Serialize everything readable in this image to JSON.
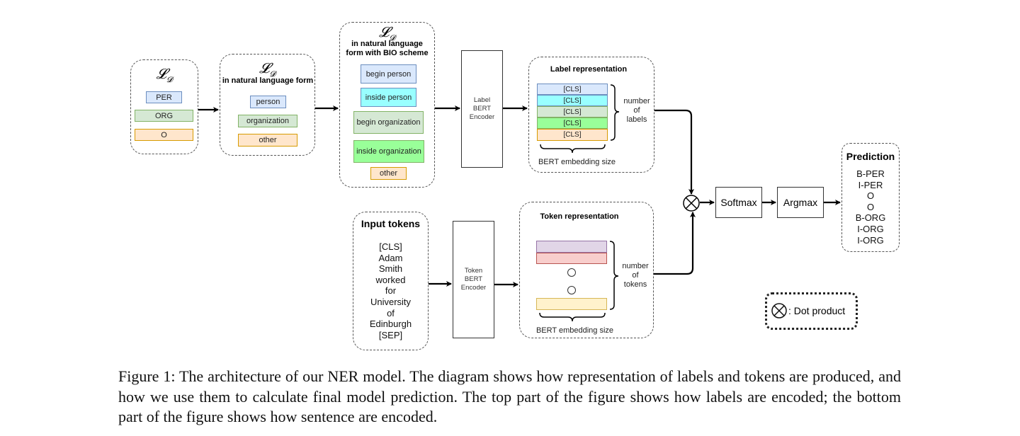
{
  "domain": "Diagram",
  "label_set": {
    "symbol": "𝓛",
    "subscript": "𝓓",
    "items": [
      {
        "text": "PER",
        "color": "#dae8fc"
      },
      {
        "text": "ORG",
        "color": "#d5e8d4"
      },
      {
        "text": "O",
        "color": "#ffe6cc"
      }
    ]
  },
  "label_set_natural": {
    "symbol": "𝓛",
    "subscript": "𝓓",
    "title": "in natural language form",
    "items": [
      {
        "text": "person",
        "color": "#dae8fc"
      },
      {
        "text": "organization",
        "color": "#d5e8d4"
      },
      {
        "text": "other",
        "color": "#ffe6cc"
      }
    ]
  },
  "label_set_bio": {
    "symbol": "𝓛",
    "subscript": "𝓓",
    "title_line1": "in natural language",
    "title_line2": "form with BIO scheme",
    "items": [
      {
        "text": "begin person",
        "color": "#dae8fc"
      },
      {
        "text": "inside person",
        "color": "#99ffff"
      },
      {
        "text": "begin organization",
        "color": "#d5e8d4"
      },
      {
        "text": "inside organization",
        "color": "#99ff99"
      },
      {
        "text": "other",
        "color": "#ffe6cc"
      }
    ]
  },
  "label_encoder": {
    "text": "Label\nBERT\nEncoder"
  },
  "label_representation": {
    "title": "Label representation",
    "rows": [
      "[CLS]",
      "[CLS]",
      "[CLS]",
      "[CLS]",
      "[CLS]"
    ],
    "brace_right": "number\nof\nlabels",
    "brace_bottom": "BERT embedding size"
  },
  "input_tokens": {
    "title": "Input tokens",
    "tokens": [
      "[CLS]",
      "Adam",
      "Smith",
      "worked",
      "for",
      "University",
      "of",
      "Edinburgh",
      "[SEP]"
    ]
  },
  "token_encoder": {
    "text": "Token\nBERT\nEncoder"
  },
  "token_representation": {
    "title": "Token representation",
    "brace_right": "number\nof\ntokens",
    "brace_bottom": "BERT embedding size"
  },
  "operations": {
    "dot_product_symbol": "⊗",
    "softmax": "Softmax",
    "argmax": "Argmax"
  },
  "prediction": {
    "title": "Prediction",
    "labels": [
      "B-PER",
      "I-PER",
      "O",
      "O",
      "B-ORG",
      "I-ORG",
      "I-ORG"
    ]
  },
  "legend": {
    "symbol": "⊗",
    "text": ": Dot product"
  },
  "caption": "Figure 1: The architecture of our NER model. The diagram shows how representation of labels and tokens are produced, and how we use them to calculate final model prediction. The top part of the figure shows how labels are encoded; the bottom part of the figure shows how sentence are encoded."
}
